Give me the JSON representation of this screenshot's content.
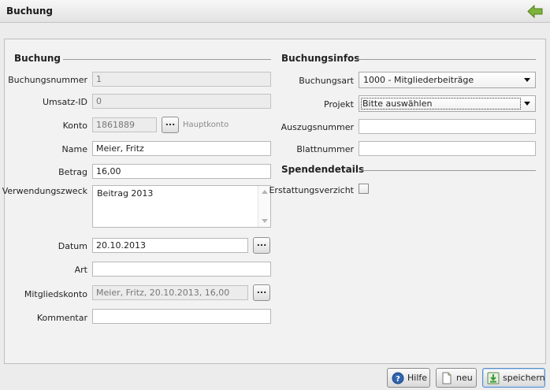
{
  "window": {
    "title": "Buchung"
  },
  "buchung": {
    "section_title": "Buchung",
    "fields": {
      "buchungsnummer": {
        "label": "Buchungsnummer",
        "value": "1"
      },
      "umsatz_id": {
        "label": "Umsatz-ID",
        "value": "0"
      },
      "konto": {
        "label": "Konto",
        "value": "1861889",
        "button": "...",
        "hint": "Hauptkonto"
      },
      "name": {
        "label": "Name",
        "value": "Meier, Fritz"
      },
      "betrag": {
        "label": "Betrag",
        "value": "16,00"
      },
      "verwendungszweck": {
        "label": "Verwendungszweck",
        "value": "Beitrag 2013"
      },
      "datum": {
        "label": "Datum",
        "value": "20.10.2013",
        "button": "..."
      },
      "art": {
        "label": "Art",
        "value": ""
      },
      "mitgliedskonto": {
        "label": "Mitgliedskonto",
        "value": "Meier, Fritz, 20.10.2013, 16,00",
        "button": "..."
      },
      "kommentar": {
        "label": "Kommentar",
        "value": ""
      }
    }
  },
  "buchungsinfos": {
    "section_title": "Buchungsinfos",
    "fields": {
      "buchungsart": {
        "label": "Buchungsart",
        "value": "1000 - Mitgliederbeiträge"
      },
      "projekt": {
        "label": "Projekt",
        "value": "Bitte auswählen"
      },
      "auszugsnummer": {
        "label": "Auszugsnummer",
        "value": ""
      },
      "blattnummer": {
        "label": "Blattnummer",
        "value": ""
      }
    }
  },
  "spendendetails": {
    "section_title": "Spendendetails",
    "erstattungsverzicht": {
      "label": "Erstattungsverzicht",
      "checked": false
    }
  },
  "footer": {
    "hilfe": "Hilfe",
    "neu": "neu",
    "speichern": "speichern"
  },
  "colors": {
    "back_arrow": "#7fb23a",
    "help_icon": "#2f64b0",
    "save_icon": "#3a9a3a",
    "primary_border": "#5a8fc9"
  }
}
